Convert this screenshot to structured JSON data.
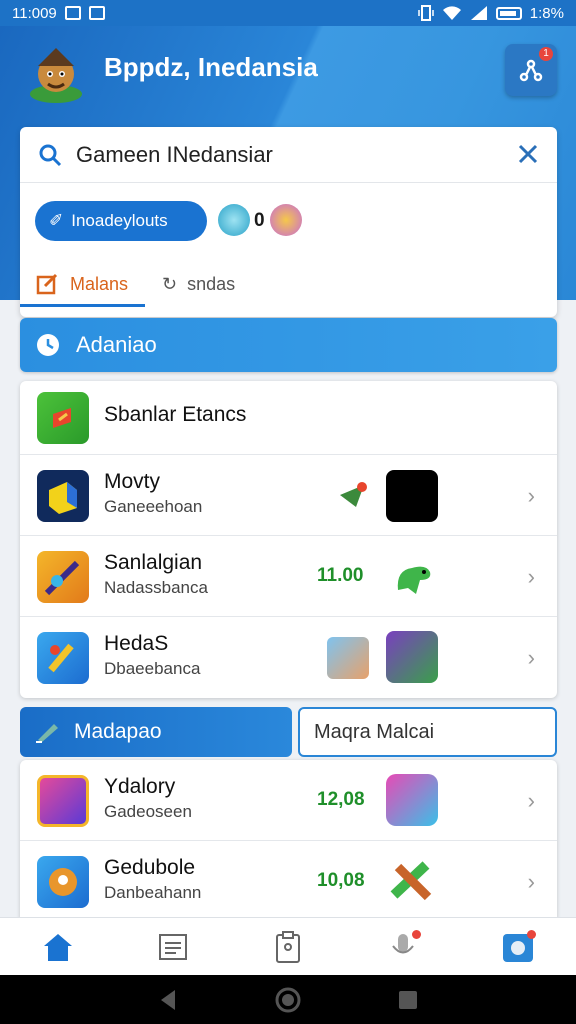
{
  "status_bar": {
    "time": "11:009",
    "battery": "1:8%"
  },
  "header": {
    "app_title": "Bppdz, Inedansia"
  },
  "search": {
    "query": "Gameen INedansiar",
    "chip_label": "Inoadeylouts",
    "coin_count": "0",
    "tabs": [
      {
        "label": "Malans",
        "active": true
      },
      {
        "label": "sndas",
        "active": false
      }
    ]
  },
  "section1": {
    "title": "Adaniao",
    "list_header": "Sbanlar Etancs",
    "rows": [
      {
        "title": "Movty",
        "subtitle": "Ganeeehoan",
        "price": ""
      },
      {
        "title": "Sanlalgian",
        "subtitle": "Nadassbanca",
        "price": "11.00"
      },
      {
        "title": "HedaS",
        "subtitle": "Dbaeebanca",
        "price": ""
      }
    ]
  },
  "section2": {
    "left_button": "Madapao",
    "right_button": "Maqra Malcai",
    "rows": [
      {
        "title": "Ydalory",
        "subtitle": "Gadeoseen",
        "price": "12,08"
      },
      {
        "title": "Gedubole",
        "subtitle": "Danbeahann",
        "price": "10,08"
      }
    ]
  },
  "colors": {
    "accent": "#1a73d1",
    "price": "#1f8f2a",
    "header": "#2a86d8"
  }
}
